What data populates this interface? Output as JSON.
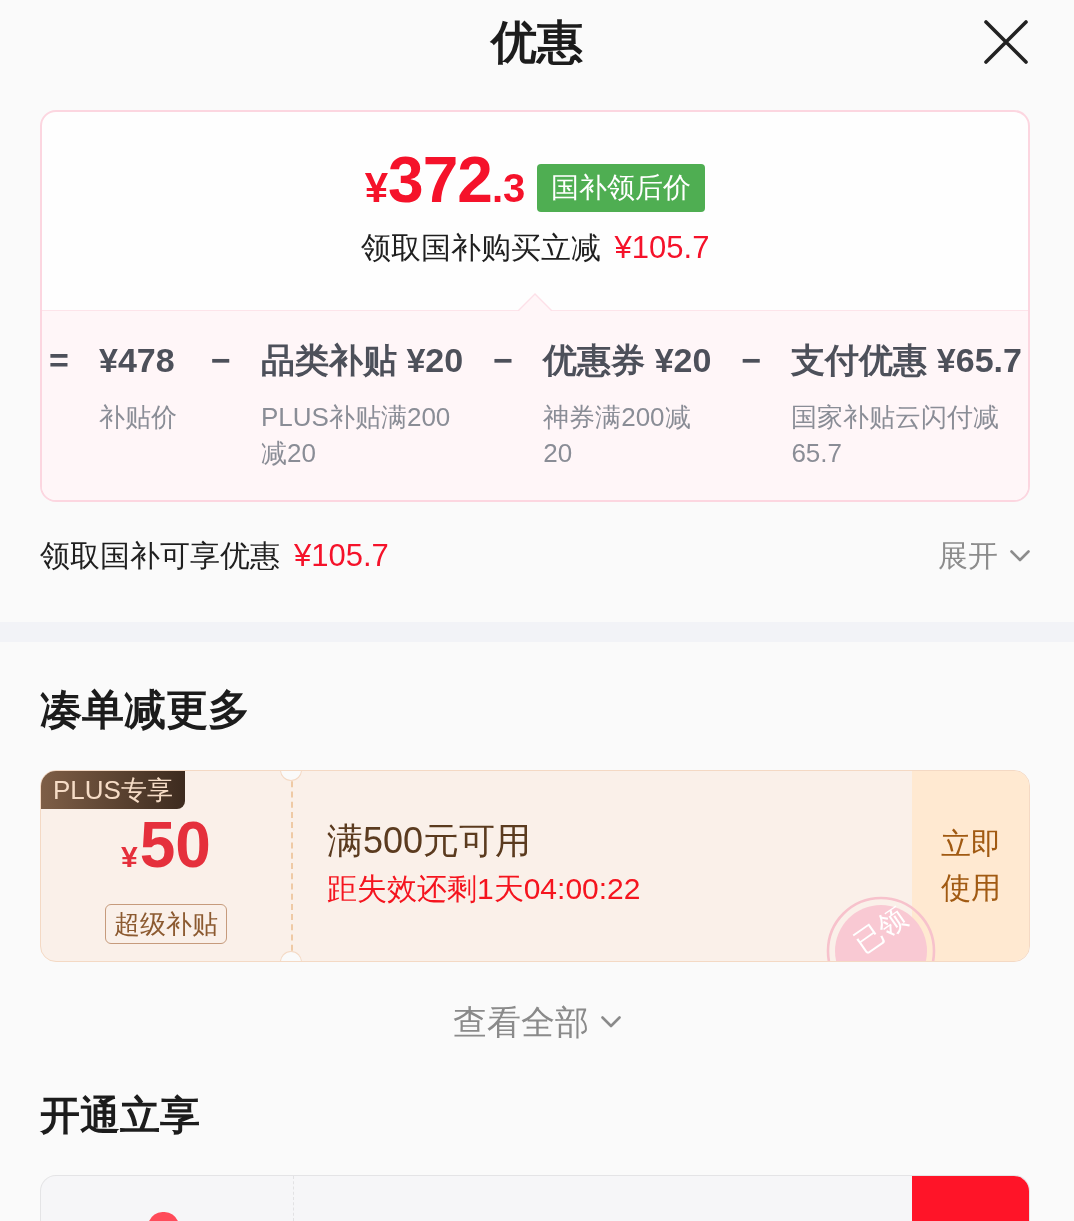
{
  "header": {
    "title": "优惠"
  },
  "price_card": {
    "price": {
      "currency": "¥",
      "whole": "372",
      "fraction": ".3"
    },
    "badge": "国补领后价",
    "subtitle": "领取国补购买立减",
    "discount": "¥105.7",
    "breakdown": [
      {
        "operator": "=",
        "value": "¥478",
        "label": "补贴价"
      },
      {
        "operator": "−",
        "value": "品类补贴 ¥20",
        "label": "PLUS补贴满200减20"
      },
      {
        "operator": "−",
        "value": "优惠券 ¥20",
        "label": "神券满200减20"
      },
      {
        "operator": "−",
        "value": "支付优惠 ¥65.7",
        "label": "国家补贴云闪付减65.7"
      }
    ]
  },
  "summary": {
    "text": "领取国补可享优惠",
    "amount": "¥105.7",
    "toggle": "展开"
  },
  "coupon_section": {
    "title": "凑单减更多",
    "coupons": [
      {
        "tag": "PLUS专享",
        "currency": "¥",
        "amount": "50",
        "badge": "超级补贴",
        "condition": "满500元可用",
        "countdown": "距失效还剩1天04:00:22",
        "action": "立即使用",
        "stamp": "已领"
      }
    ],
    "view_all": "查看全部"
  },
  "membership_section": {
    "title": "开通立享"
  }
}
